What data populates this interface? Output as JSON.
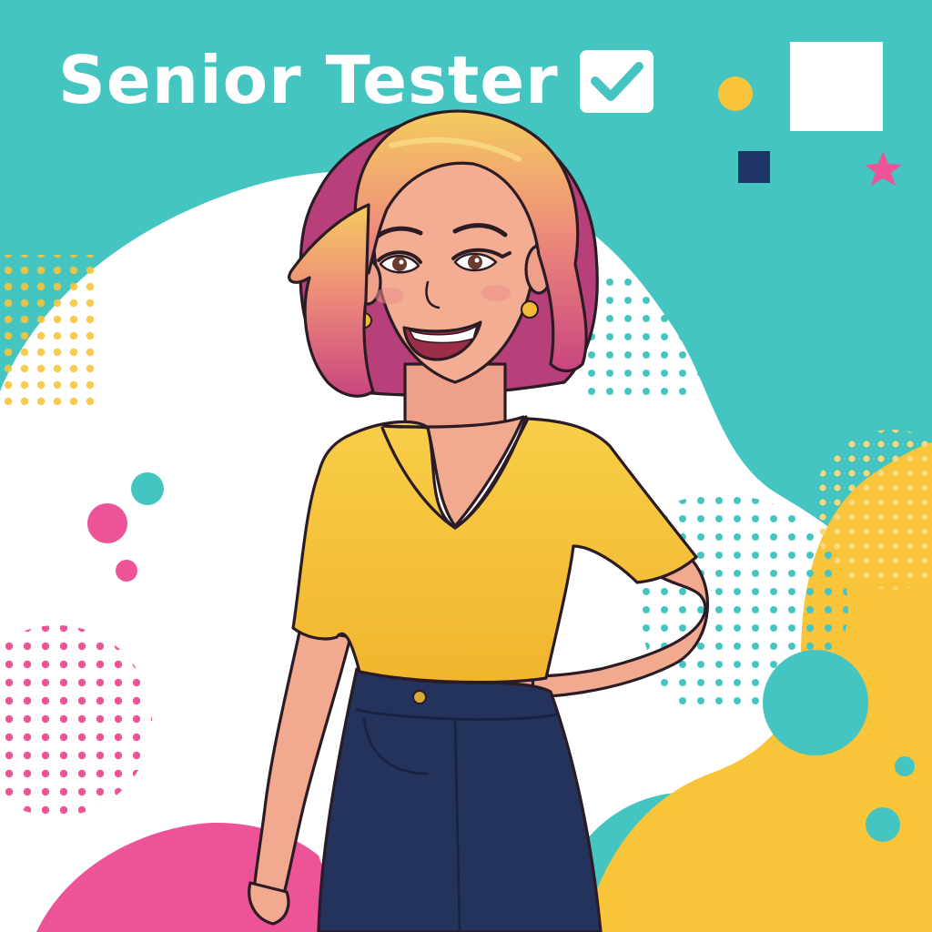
{
  "title": "Senior Tester",
  "colors": {
    "teal": "#45c5c1",
    "pink": "#ec5497",
    "yellow": "#f7c43a",
    "navy": "#1f3466",
    "white": "#ffffff",
    "skin": "#f1a98f",
    "shirt": "#f6c53d",
    "jeans": "#24335c",
    "hair_top": "#f2c45a",
    "hair_bottom": "#d9578e",
    "outline": "#2a1b24"
  },
  "icons": [
    "check-box-icon",
    "white-square",
    "navy-square",
    "pink-star",
    "yellow-dot"
  ]
}
